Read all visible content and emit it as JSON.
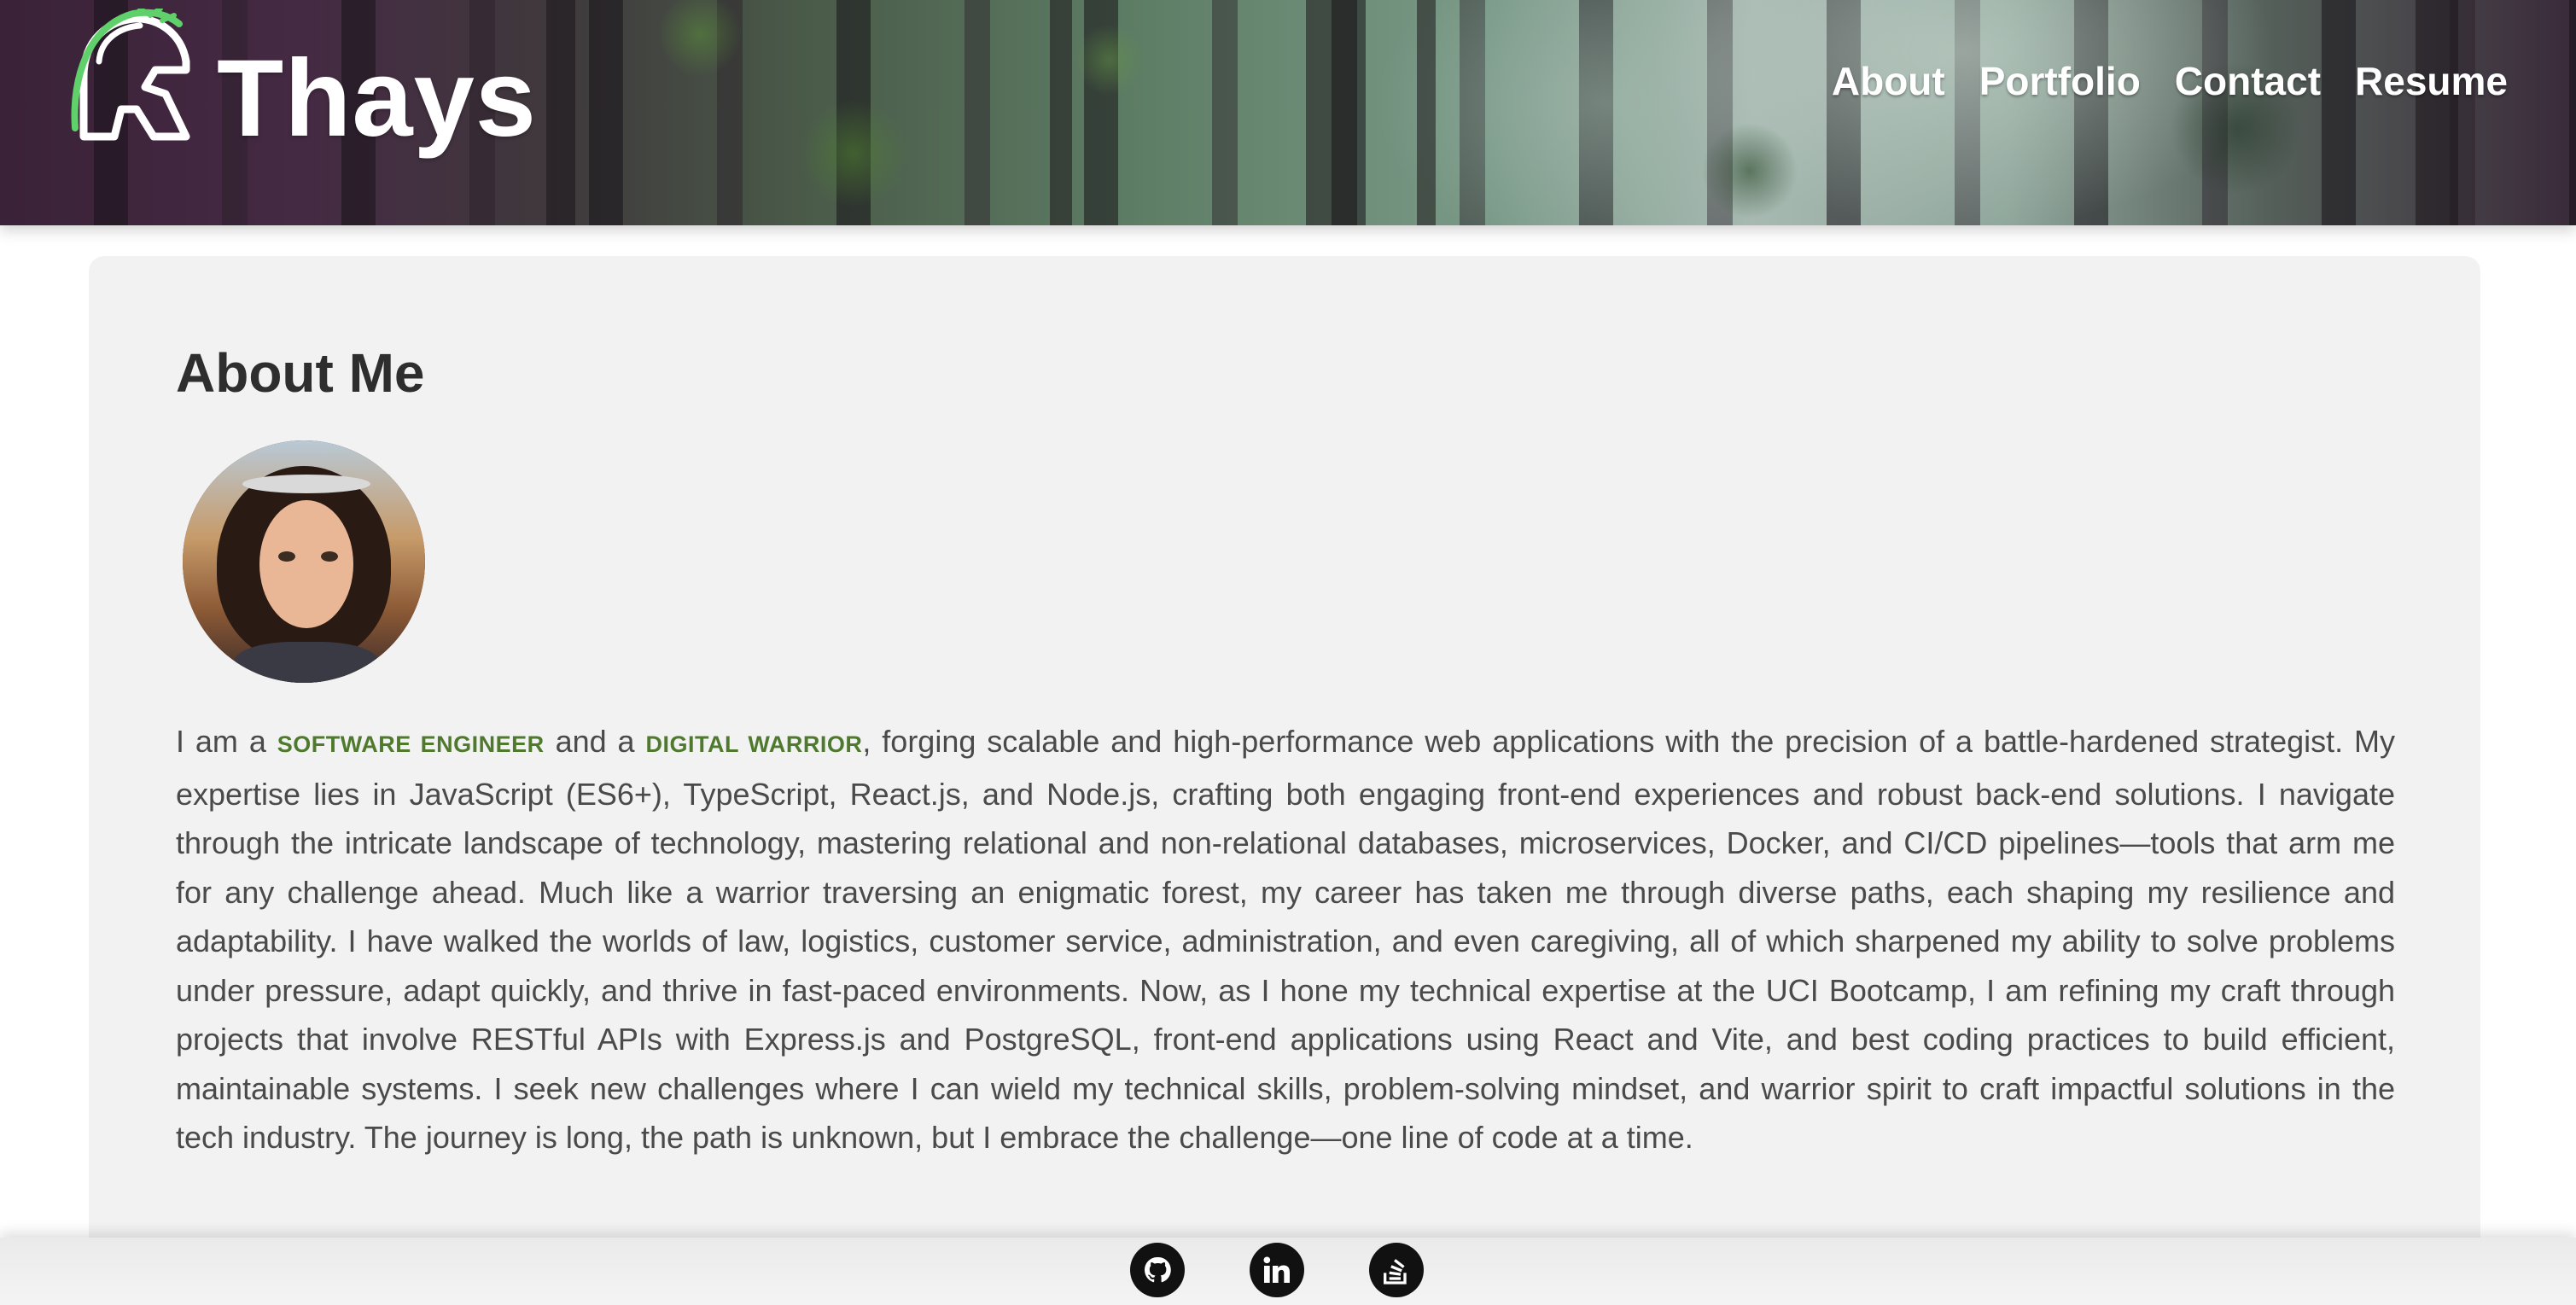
{
  "header": {
    "brand": "Thays",
    "nav": [
      {
        "label": "About"
      },
      {
        "label": "Portfolio"
      },
      {
        "label": "Contact"
      },
      {
        "label": "Resume"
      }
    ]
  },
  "about": {
    "title": "About Me",
    "bio": {
      "p1": "I am a ",
      "h1": "Software Engineer",
      "p2": " and a ",
      "h2": "Digital Warrior",
      "p3": ", forging scalable and high-performance web applications with the precision of a battle-hardened strategist. My expertise lies in JavaScript (ES6+), TypeScript, React.js, and Node.js, crafting both engaging front-end experiences and robust back-end solutions. I navigate through the intricate landscape of technology, mastering relational and non-relational databases, microservices, Docker, and CI/CD pipelines—tools that arm me for any challenge ahead. Much like a warrior traversing an enigmatic forest, my career has taken me through diverse paths, each shaping my resilience and adaptability. I have walked the worlds of law, logistics, customer service, administration, and even caregiving, all of which sharpened my ability to solve problems under pressure, adapt quickly, and thrive in fast-paced environments. Now, as I hone my technical expertise at the UCI Bootcamp, I am refining my craft through projects that involve RESTful APIs with Express.js and PostgreSQL, front-end applications using React and Vite, and best coding practices to build efficient, maintainable systems. I seek new challenges where I can wield my technical skills, problem-solving mindset, and warrior spirit to craft impactful solutions in the tech industry. The journey is long, the path is unknown, but I embrace the challenge—one line of code at a time."
    }
  },
  "footer": {
    "social": [
      {
        "icon": "github-icon"
      },
      {
        "icon": "linkedin-icon"
      },
      {
        "icon": "stackoverflow-icon"
      }
    ]
  },
  "colors": {
    "accent": "#4f7a2e",
    "logo": "#5fd06a",
    "card": "#f2f2f2"
  }
}
